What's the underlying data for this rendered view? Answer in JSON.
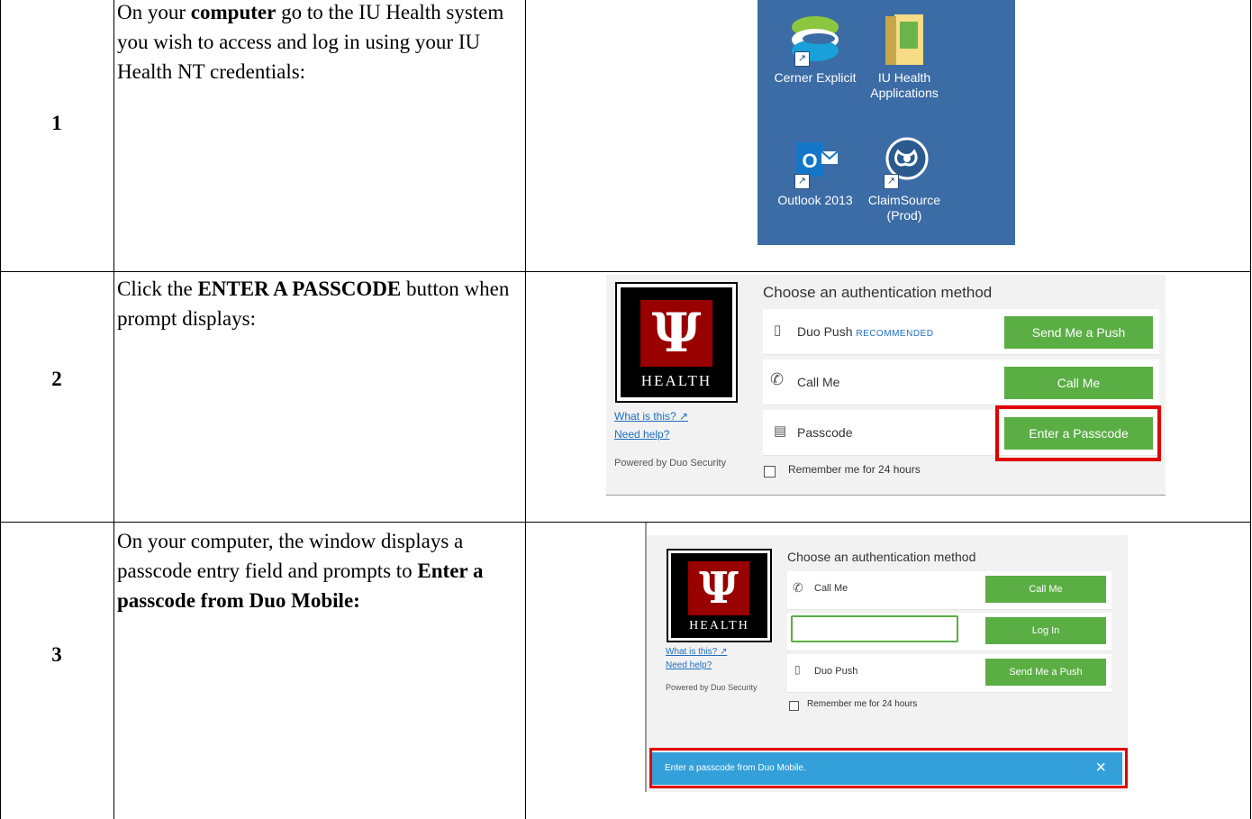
{
  "steps": [
    {
      "number": "1",
      "text_before": "On your ",
      "bold": "computer",
      "text_after": " go to the IU Health system you wish to access and log in using your IU Health NT credentials:"
    },
    {
      "number": "2",
      "text_before": "Click the ",
      "bold": "ENTER A PASSCODE",
      "text_after": " button when prompt displays:"
    },
    {
      "number": "3",
      "text_before": "On your computer, the window displays a passcode entry field and prompts to ",
      "bold": "Enter a passcode from Duo Mobile:",
      "text_after": ""
    }
  ],
  "desktop": {
    "background": "#3b6ca5",
    "icons": [
      {
        "icon": "cerner-icon",
        "label": "Cerner Explicit"
      },
      {
        "icon": "folder-icon",
        "label": "IU Health Applications"
      },
      {
        "icon": "outlook-icon",
        "label": "Outlook 2013"
      },
      {
        "icon": "claimsource-icon",
        "label": "ClaimSource (Prod)"
      }
    ]
  },
  "duo_prompt": {
    "logo_text": "HEALTH",
    "title": "Choose an authentication method",
    "what_is_this": "What is this?",
    "need_help": "Need help?",
    "powered_by": "Powered by Duo Security",
    "methods": [
      {
        "label": "Duo Push",
        "tag": "RECOMMENDED",
        "button": "Send Me a Push"
      },
      {
        "label": "Call Me",
        "button": "Call Me"
      },
      {
        "label": "Passcode",
        "button": "Enter a Passcode"
      }
    ],
    "remember": "Remember me for 24 hours",
    "accent": "#5aae44",
    "highlight": "#e10000"
  },
  "duo_passcode": {
    "logo_text": "HEALTH",
    "title": "Choose an authentication method",
    "what_is_this": "What is this?",
    "need_help": "Need help?",
    "powered_by": "Powered by Duo Security",
    "call_label": "Call Me",
    "call_button": "Call Me",
    "passcode_value": "",
    "login_button": "Log In",
    "push_label": "Duo Push",
    "push_button": "Send Me a Push",
    "remember": "Remember me for 24 hours",
    "banner_text": "Enter a passcode from Duo Mobile.",
    "banner_close": "×",
    "banner_color": "#33a0da"
  }
}
